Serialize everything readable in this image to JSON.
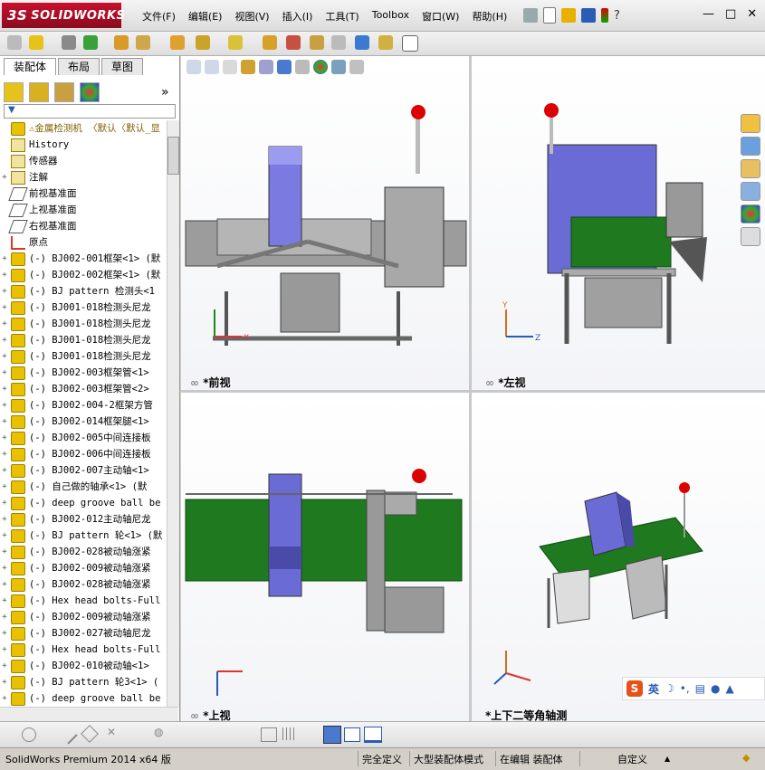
{
  "app": {
    "logo_prefix": "3S",
    "logo_text": "SOLIDWORKS",
    "version_status": "SolidWorks Premium 2014 x64 版"
  },
  "menu": [
    "文件(F)",
    "编辑(E)",
    "视图(V)",
    "插入(I)",
    "工具(T)",
    "Toolbox",
    "窗口(W)",
    "帮助(H)"
  ],
  "window_buttons": {
    "help": "?",
    "minimize": "—",
    "restore": "□",
    "close": "✕"
  },
  "panel_tabs": [
    "装配体",
    "布局",
    "草图"
  ],
  "panel_expand": "»",
  "filter_icon": "filter-icon",
  "tree": {
    "root": "金属检测机  〈默认〈默认_显",
    "items": [
      {
        "label": "History",
        "icon": "history-icon"
      },
      {
        "label": "传感器",
        "icon": "sensor-icon"
      },
      {
        "label": "注解",
        "icon": "annotation-icon",
        "expand": "+"
      },
      {
        "label": "前视基准面",
        "icon": "plane-icon"
      },
      {
        "label": "上视基准面",
        "icon": "plane-icon"
      },
      {
        "label": "右视基准面",
        "icon": "plane-icon"
      },
      {
        "label": "原点",
        "icon": "origin-icon"
      },
      {
        "label": "(-) BJ002-001框架<1> (默",
        "icon": "part-icon",
        "expand": "+"
      },
      {
        "label": "(-) BJ002-002框架<1> (默",
        "icon": "part-icon",
        "expand": "+"
      },
      {
        "label": "(-) BJ pattern 检测头<1",
        "icon": "part-icon",
        "expand": "+"
      },
      {
        "label": "(-) BJ001-018检测头尼龙",
        "icon": "part-icon",
        "expand": "+"
      },
      {
        "label": "(-) BJ001-018检测头尼龙",
        "icon": "part-icon",
        "expand": "+"
      },
      {
        "label": "(-) BJ001-018检测头尼龙",
        "icon": "part-icon",
        "expand": "+"
      },
      {
        "label": "(-) BJ001-018检测头尼龙",
        "icon": "part-icon",
        "expand": "+"
      },
      {
        "label": "(-) BJ002-003框架管<1>",
        "icon": "part-icon",
        "expand": "+"
      },
      {
        "label": "(-) BJ002-003框架管<2>",
        "icon": "part-icon",
        "expand": "+"
      },
      {
        "label": "(-) BJ002-004-2框架方管",
        "icon": "part-icon",
        "expand": "+"
      },
      {
        "label": "(-) BJ002-014框架腿<1>",
        "icon": "part-icon",
        "expand": "+"
      },
      {
        "label": "(-) BJ002-005中间连接板",
        "icon": "part-icon",
        "expand": "+"
      },
      {
        "label": "(-) BJ002-006中间连接板",
        "icon": "part-icon",
        "expand": "+"
      },
      {
        "label": "(-) BJ002-007主动轴<1>",
        "icon": "part-icon",
        "expand": "+"
      },
      {
        "label": "(-) 自己做的轴承<1> (默",
        "icon": "part-icon",
        "expand": "+"
      },
      {
        "label": "(-) deep groove ball be",
        "icon": "part-icon",
        "expand": "+"
      },
      {
        "label": "(-) BJ002-012主动轴尼龙",
        "icon": "part-icon",
        "expand": "+"
      },
      {
        "label": "(-) BJ pattern 轮<1> (默",
        "icon": "part-icon",
        "expand": "+"
      },
      {
        "label": "(-) BJ002-028被动轴涨紧",
        "icon": "part-icon",
        "expand": "+"
      },
      {
        "label": "(-) BJ002-009被动轴涨紧",
        "icon": "part-icon",
        "expand": "+"
      },
      {
        "label": "(-) BJ002-028被动轴涨紧",
        "icon": "part-icon",
        "expand": "+"
      },
      {
        "label": "(-) Hex head bolts-Full",
        "icon": "part-icon",
        "expand": "+"
      },
      {
        "label": "(-) BJ002-009被动轴涨紧",
        "icon": "part-icon",
        "expand": "+"
      },
      {
        "label": "(-) BJ002-027被动轴尼龙",
        "icon": "part-icon",
        "expand": "+"
      },
      {
        "label": "(-) Hex head bolts-Full",
        "icon": "part-icon",
        "expand": "+"
      },
      {
        "label": "(-) BJ002-010被动轴<1>",
        "icon": "part-icon",
        "expand": "+"
      },
      {
        "label": "(-) BJ pattern 轮3<1> (",
        "icon": "part-icon",
        "expand": "+"
      },
      {
        "label": "(-) deep groove ball be",
        "icon": "part-icon",
        "expand": "+"
      }
    ]
  },
  "viewports": {
    "front": "*前视",
    "left": "*左视",
    "top": "*上视",
    "iso": "*上下二等角轴测"
  },
  "axis_labels": {
    "x": "X",
    "y": "Y",
    "z": "Z"
  },
  "ime": {
    "label": "英",
    "moon": "☽"
  },
  "status": {
    "fully_defined": "完全定义",
    "large_assembly": "大型装配体模式",
    "editing": "在编辑 装配体",
    "custom": "自定义",
    "custom_arrow": "▲"
  },
  "colors": {
    "brand": "#c8102e",
    "belt": "#1f7a1f",
    "detector": "#6b6bd6",
    "frame": "#8c8c8c"
  }
}
